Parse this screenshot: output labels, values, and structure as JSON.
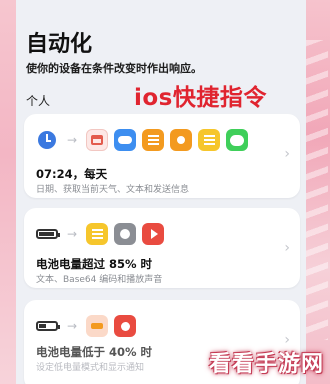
{
  "header": {
    "title": "自动化",
    "subtitle": "使你的设备在条件改变时作出响应。",
    "section": "个人"
  },
  "overlay_text": "ios快捷指令",
  "cards": [
    {
      "title": "07:24，每天",
      "subtitle": "日期、获取当前天气、文本和发送信息",
      "trigger_icon": "clock-icon",
      "action_icons": [
        "calendar-icon",
        "weather-icon",
        "list-icon",
        "text-icon",
        "notes-icon",
        "messages-icon"
      ]
    },
    {
      "title": "电池电量超过 85% 时",
      "subtitle": "文本、Base64 编码和播放声音",
      "trigger_icon": "battery-icon",
      "battery_level": 0.85,
      "action_icons": [
        "text-icon",
        "stop-icon",
        "play-sound-icon"
      ]
    },
    {
      "title": "电池电量低于 40% 时",
      "subtitle": "设定低电量模式和显示通知",
      "trigger_icon": "battery-icon",
      "battery_level": 0.4,
      "action_icons": [
        "low-power-icon",
        "notification-icon"
      ]
    }
  ],
  "watermark": "看看手游网",
  "colors": {
    "overlay_red": "#e0242f",
    "accent_blue": "#3b79e0",
    "background_pink": "#f3b6c4"
  }
}
